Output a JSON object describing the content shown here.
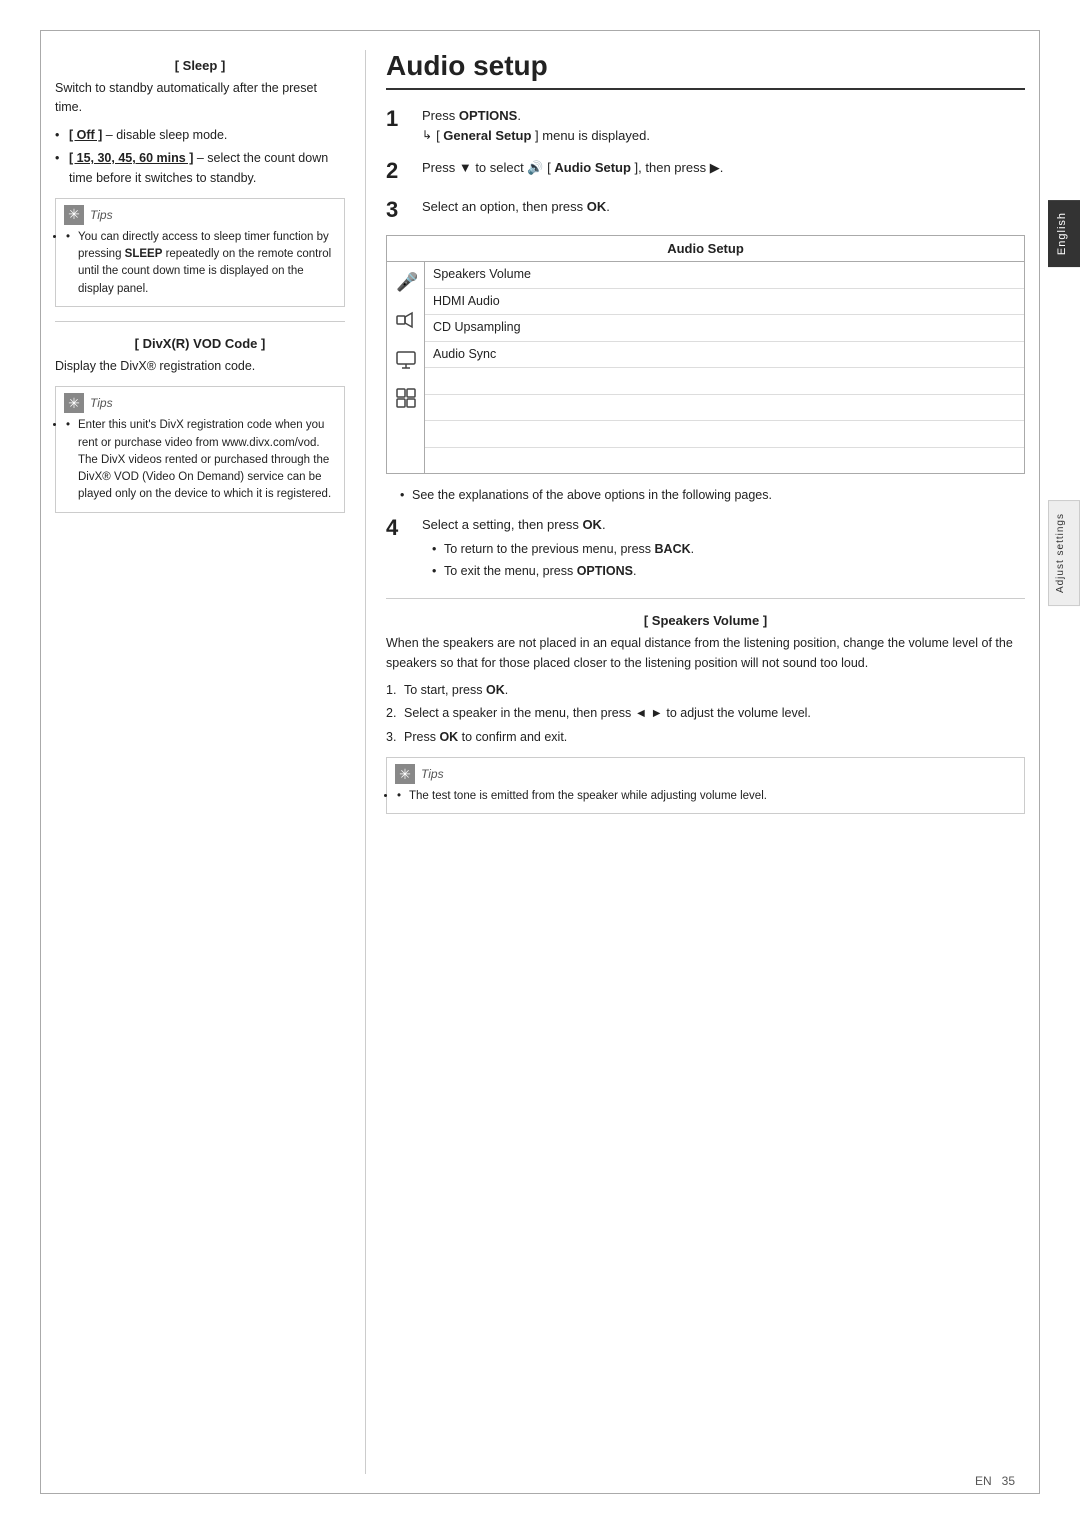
{
  "page": {
    "number": "35",
    "language_label": "EN"
  },
  "side_tabs": {
    "english": "English",
    "adjust": "Adjust settings"
  },
  "left_column": {
    "sleep_section": {
      "heading": "[ Sleep ]",
      "text": "Switch to standby automatically after the preset time.",
      "bullets": [
        "[ Off ] – disable sleep mode.",
        "[ 15, 30, 45, 60 mins ] – select the count down time before it switches to standby."
      ]
    },
    "tips1": {
      "label": "Tips",
      "content": "You can directly access to sleep timer function by pressing SLEEP repeatedly on the remote control until the count down time is displayed on the display panel."
    },
    "divx_section": {
      "heading": "[ DivX(R) VOD Code ]",
      "text": "Display the DivX® registration code."
    },
    "tips2": {
      "label": "Tips",
      "content": "Enter this unit's DivX registration code when you rent or purchase video from www.divx.com/vod. The DivX videos rented or purchased through the DivX® VOD (Video On Demand) service can be played only on the device to which it is registered."
    }
  },
  "right_column": {
    "title": "Audio setup",
    "steps": [
      {
        "number": "1",
        "main": "Press OPTIONS.",
        "sub": "[ General Setup ] menu is displayed.",
        "has_arrow": true
      },
      {
        "number": "2",
        "main": "Press ▼ to select  [ Audio Setup ], then press ▶.",
        "has_arrow": false
      },
      {
        "number": "3",
        "main": "Select an option, then press OK.",
        "has_arrow": false
      }
    ],
    "audio_table": {
      "header": "Audio Setup",
      "rows": [
        "Speakers Volume",
        "HDMI Audio",
        "CD Upsampling",
        "Audio Sync",
        "",
        "",
        "",
        ""
      ]
    },
    "see_note": "See the explanations of the above options in the following pages.",
    "step4": {
      "number": "4",
      "main": "Select a setting, then press OK.",
      "bullets": [
        "To return to the previous menu, press BACK.",
        "To exit the menu, press OPTIONS."
      ]
    },
    "speakers_section": {
      "heading": "[ Speakers Volume ]",
      "text": "When the speakers are not placed in an equal distance from the listening position, change the volume level of the speakers so that for those placed closer to the listening position will not sound too loud.",
      "ordered": [
        "To start, press OK.",
        "Select a speaker in the menu, then press ◄ ► to adjust the volume level.",
        "Press OK to confirm and exit."
      ]
    },
    "tips3": {
      "label": "Tips",
      "content": "The test tone is emitted from the speaker while adjusting volume level."
    }
  }
}
